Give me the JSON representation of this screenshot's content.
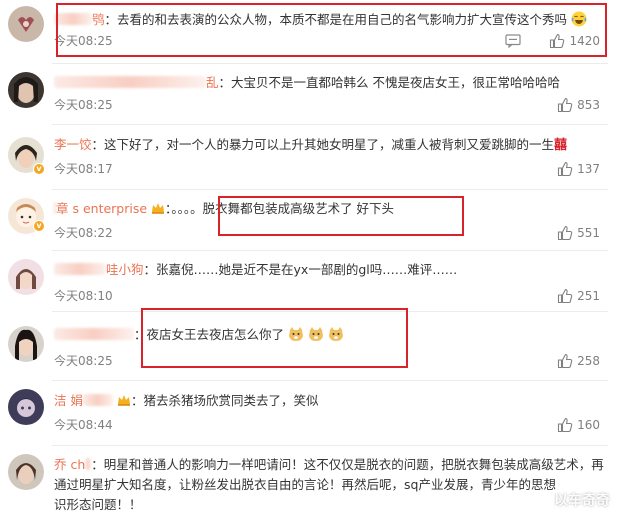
{
  "comments": [
    {
      "user": "鸮",
      "text": "去看的和去表演的公众人物，本质不都是在用自己的名气影响力扩大宣传这个秀吗",
      "time": "今天08:25",
      "likes": "1420",
      "emoji": "laugh-cry",
      "highlighted": true
    },
    {
      "user": "乱",
      "text": "大宝贝不是一直都哈韩么 不愧是夜店女王，很正常哈哈哈哈",
      "time": "今天08:25",
      "likes": "853"
    },
    {
      "user": "李一饺",
      "text": "这下好了，对一个人的暴力可以上升其她女明星了，减重人被背刺又爱跳脚的一生",
      "xi": "囍",
      "time": "今天08:17",
      "likes": "137"
    },
    {
      "user": "章 s enterprise",
      "text": "。。。。脱衣舞都包装成高级艺术了 好下头",
      "time": "今天08:22",
      "likes": "551",
      "highlighted": true
    },
    {
      "user": "哇小狗",
      "text": "张嘉倪……她是近不是在yx一部剧的gl吗……难评……",
      "time": "今天08:10",
      "likes": "251"
    },
    {
      "user": "",
      "text": "夜店女王去夜店怎么你了",
      "time": "今天08:25",
      "likes": "258",
      "highlighted": true
    },
    {
      "user": "洁 娟",
      "text": "猪去杀猪场欣赏同类去了，笑似",
      "time": "今天08:44",
      "likes": "160"
    },
    {
      "user": "乔  ch",
      "text_lines": [
        "明星和普通人的影响力一样吧请问！这不仅仅是脱衣的问题，把脱衣舞包装成高级艺术，再",
        "通过明星扩大知名度，让粉丝发出脱衣自由的言论！再然后呢，sq产业发展，青少年的思想",
        "识形态问题！！"
      ]
    }
  ],
  "watermark": "以车奇奇",
  "colors": {
    "username": "#eb7350",
    "highlight_border": "#d8232a",
    "meta": "#808080"
  }
}
